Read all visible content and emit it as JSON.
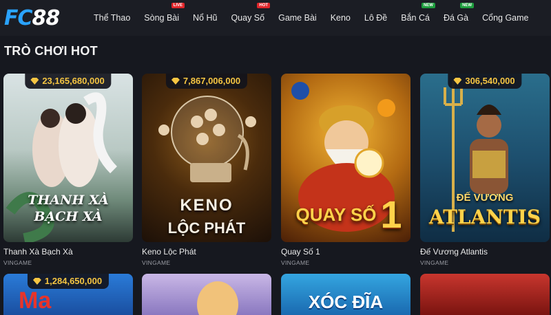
{
  "header": {
    "logo_fc": "FC",
    "logo_num": "88",
    "nav": [
      {
        "label": "Thể Thao",
        "badge": ""
      },
      {
        "label": "Sòng Bài",
        "badge": "LIVE"
      },
      {
        "label": "Nổ Hũ",
        "badge": ""
      },
      {
        "label": "Quay Số",
        "badge": "HOT"
      },
      {
        "label": "Game Bài",
        "badge": ""
      },
      {
        "label": "Keno",
        "badge": ""
      },
      {
        "label": "Lô Đề",
        "badge": ""
      },
      {
        "label": "Bắn Cá",
        "badge": "NEW"
      },
      {
        "label": "Đá Gà",
        "badge": "NEW"
      },
      {
        "label": "Cổng Game",
        "badge": ""
      }
    ]
  },
  "section": {
    "title": "TRÒ CHƠI HOT"
  },
  "games": [
    {
      "name": "Thanh Xà Bạch Xà",
      "provider": "VINGAME",
      "jackpot": "23,165,680,000",
      "art_title": "THANH XÀ BẠCH XÀ"
    },
    {
      "name": "Keno Lộc Phát",
      "provider": "VINGAME",
      "jackpot": "7,867,006,000",
      "art_title_1": "KENO",
      "art_title_2": "LỘC PHÁT"
    },
    {
      "name": "Quay Số 1",
      "provider": "VINGAME",
      "jackpot": "",
      "art_title": "QUAY SỐ",
      "art_num": "1"
    },
    {
      "name": "Đế Vương Atlantis",
      "provider": "VINGAME",
      "jackpot": "306,540,000",
      "art_title_1": "ĐẾ VƯƠNG",
      "art_title_2": "ATLANTIS"
    }
  ],
  "row2": [
    {
      "jackpot": "1,284,650,000",
      "art_title": ""
    },
    {
      "jackpot": "",
      "art_title": ""
    },
    {
      "jackpot": "",
      "art_title": "XÓC ĐĨA"
    },
    {
      "jackpot": "",
      "art_title": ""
    }
  ],
  "colors": {
    "background": "#16181f",
    "header": "#1b1d24",
    "logo_accent": "#2aa3ff",
    "jackpot_text": "#f5c542",
    "badge_red": "#e0262b",
    "badge_green": "#1e9e3e"
  }
}
